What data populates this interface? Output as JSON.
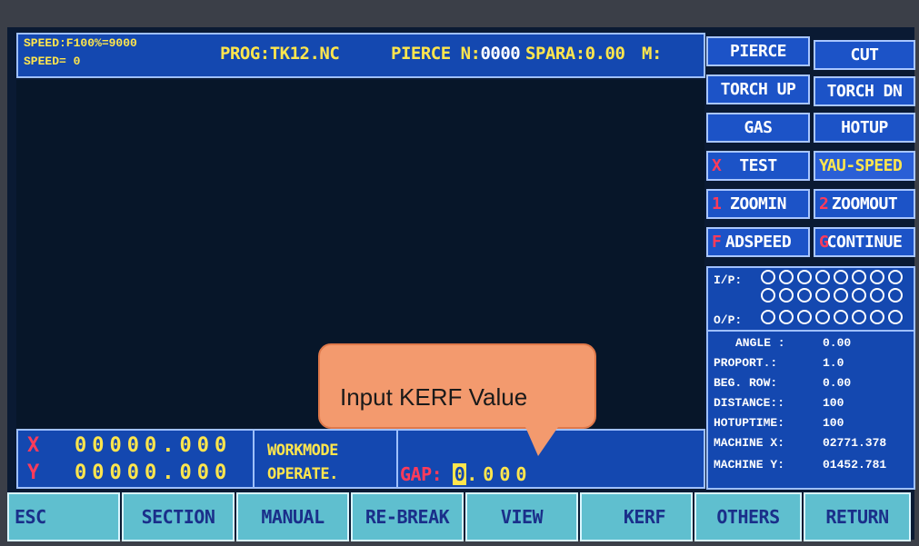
{
  "header": {
    "speed_line1": "SPEED:F100%=9000",
    "speed_line2": "SPEED= 0",
    "prog": "PROG:TK12.NC",
    "pierce_label": "PIERCE N:",
    "pierce_value": "0000",
    "spara": "SPARA:0.00",
    "m_label": "M:"
  },
  "side_buttons": [
    {
      "label": "PIERCE",
      "key": ""
    },
    {
      "label": "CUT",
      "key": ""
    },
    {
      "label": "TORCH UP",
      "key": ""
    },
    {
      "label": "TORCH DN",
      "key": ""
    },
    {
      "label": "GAS",
      "key": ""
    },
    {
      "label": "HOTUP",
      "key": ""
    },
    {
      "label": "TEST",
      "key": "X"
    },
    {
      "label": "AU-SPEED",
      "key": "Y"
    },
    {
      "label": "ZOOMIN",
      "key": "1"
    },
    {
      "label": "ZOOMOUT",
      "key": "2"
    },
    {
      "label": "ADSPEED",
      "key": "F"
    },
    {
      "label": "CONTINUE",
      "key": "G"
    }
  ],
  "io": {
    "ip_label": "I/P:",
    "op_label": "O/P:"
  },
  "params": [
    {
      "label": "ANGLE :",
      "value": "0.00"
    },
    {
      "label": "PROPORT.:",
      "value": "1.0"
    },
    {
      "label": "BEG. ROW:",
      "value": "0.00"
    },
    {
      "label": "DISTANCE::",
      "value": "100"
    },
    {
      "label": "HOTUPTIME:",
      "value": "100"
    },
    {
      "label": "MACHINE X:",
      "value": "02771.378"
    },
    {
      "label": "MACHINE Y:",
      "value": "01452.781"
    }
  ],
  "coords": {
    "x_axis": "X",
    "x_value": "00000.000",
    "y_axis": "Y",
    "y_value": "00000.000"
  },
  "mode": {
    "workmode": "WORKMODE",
    "operate": "OPERATE."
  },
  "gap": {
    "label": "GAP:",
    "first_digit": "0",
    "rest": ".000"
  },
  "tooltip": "Input KERF Value",
  "function_keys": [
    "ESC",
    "SECTION",
    "MANUAL",
    "RE-BREAK",
    "VIEW",
    "KERF",
    "OTHERS",
    "RETURN"
  ]
}
